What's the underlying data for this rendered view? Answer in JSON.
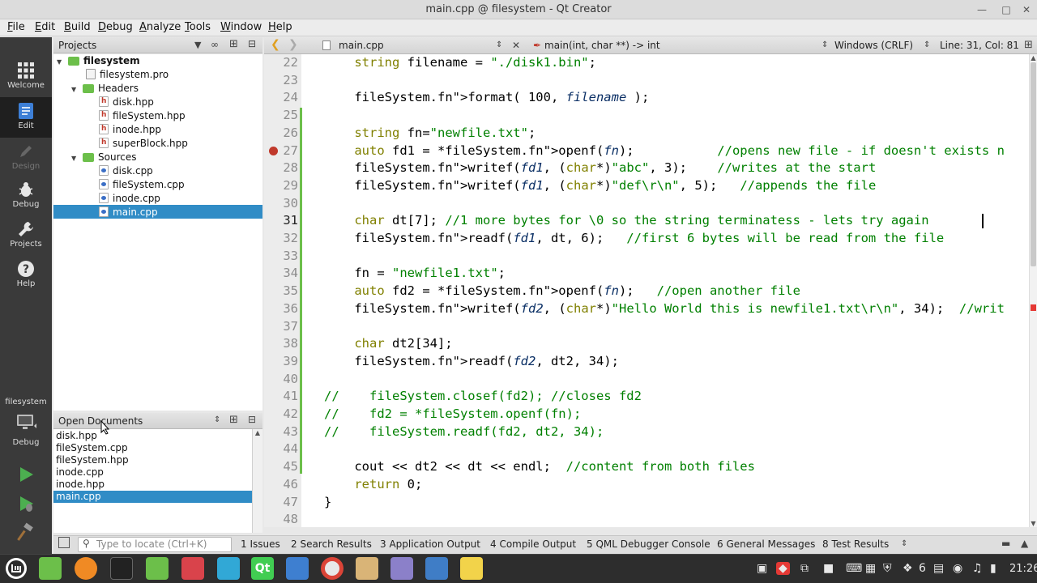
{
  "window": {
    "title": "main.cpp @ filesystem - Qt Creator"
  },
  "menu": [
    "File",
    "Edit",
    "Build",
    "Debug",
    "Analyze",
    "Tools",
    "Window",
    "Help"
  ],
  "modes": [
    {
      "label": "Welcome",
      "icon": "grid-icon"
    },
    {
      "label": "Edit",
      "icon": "document-icon"
    },
    {
      "label": "Design",
      "icon": "pencil-icon"
    },
    {
      "label": "Debug",
      "icon": "bug-icon"
    },
    {
      "label": "Projects",
      "icon": "wrench-icon"
    },
    {
      "label": "Help",
      "icon": "help-icon"
    }
  ],
  "kit": {
    "project_label": "filesystem",
    "mode_label": "Debug"
  },
  "projects_pane": {
    "title": "Projects",
    "tree": [
      {
        "label": "filesystem",
        "kind": "project",
        "bold": true
      },
      {
        "label": "filesystem.pro",
        "kind": "pro"
      },
      {
        "label": "Headers",
        "kind": "folder"
      },
      {
        "label": "disk.hpp",
        "kind": "h"
      },
      {
        "label": "fileSystem.hpp",
        "kind": "h"
      },
      {
        "label": "inode.hpp",
        "kind": "h"
      },
      {
        "label": "superBlock.hpp",
        "kind": "h"
      },
      {
        "label": "Sources",
        "kind": "folder"
      },
      {
        "label": "disk.cpp",
        "kind": "cpp"
      },
      {
        "label": "fileSystem.cpp",
        "kind": "cpp"
      },
      {
        "label": "inode.cpp",
        "kind": "cpp"
      },
      {
        "label": "main.cpp",
        "kind": "cpp",
        "selected": true
      }
    ]
  },
  "open_documents": {
    "title": "Open Documents",
    "items": [
      "disk.hpp",
      "fileSystem.cpp",
      "fileSystem.hpp",
      "inode.cpp",
      "inode.hpp",
      "main.cpp"
    ],
    "selected": "main.cpp"
  },
  "editor_toolbar": {
    "file": "main.cpp",
    "symbol": "main(int, char **) -> int",
    "line_endings": "Windows (CRLF)",
    "position": "Line: 31, Col: 81"
  },
  "editor": {
    "current_line": 31,
    "line_numbers": [
      "22",
      "23",
      "24",
      "25",
      "26",
      "27",
      "28",
      "29",
      "30",
      "31",
      "32",
      "33",
      "34",
      "35",
      "36",
      "37",
      "38",
      "39",
      "40",
      "41",
      "42",
      "43",
      "44",
      "45",
      "46",
      "47",
      "48"
    ],
    "lines": [
      "    string filename = \"./disk1.bin\";",
      "",
      "    fileSystem.format( 100, filename );",
      "",
      "    string fn=\"newfile.txt\";",
      "    auto fd1 = *fileSystem.openf(fn);           //opens new file - if doesn't exists n",
      "    fileSystem.writef(fd1, (char*)\"abc\", 3);    //writes at the start",
      "    fileSystem.writef(fd1, (char*)\"def\\r\\n\", 5);   //appends the file",
      "",
      "    char dt[7]; //1 more bytes for \\0 so the string terminatess - lets try again",
      "    fileSystem.readf(fd1, dt, 6);   //first 6 bytes will be read from the file",
      "",
      "    fn = \"newfile1.txt\";",
      "    auto fd2 = *fileSystem.openf(fn);   //open another file",
      "    fileSystem.writef(fd2, (char*)\"Hello World this is newfile1.txt\\r\\n\", 34);  //writ",
      "",
      "    char dt2[34];",
      "    fileSystem.readf(fd2, dt2, 34);",
      "",
      "//    fileSystem.closef(fd2); //closes fd2",
      "//    fd2 = *fileSystem.openf(fn);",
      "//    fileSystem.readf(fd2, dt2, 34);",
      "",
      "    cout << dt2 << dt << endl;  //content from both files",
      "    return 0;",
      "}",
      ""
    ]
  },
  "output_bar": {
    "locate_placeholder": "Type to locate (Ctrl+K)",
    "tabs": [
      "1  Issues",
      "2  Search Results",
      "3  Application Output",
      "4  Compile Output",
      "5  QML Debugger Console",
      "6  General Messages",
      "8  Test Results"
    ]
  },
  "taskbar": {
    "workspace_count": "6",
    "clock": "21:26"
  }
}
